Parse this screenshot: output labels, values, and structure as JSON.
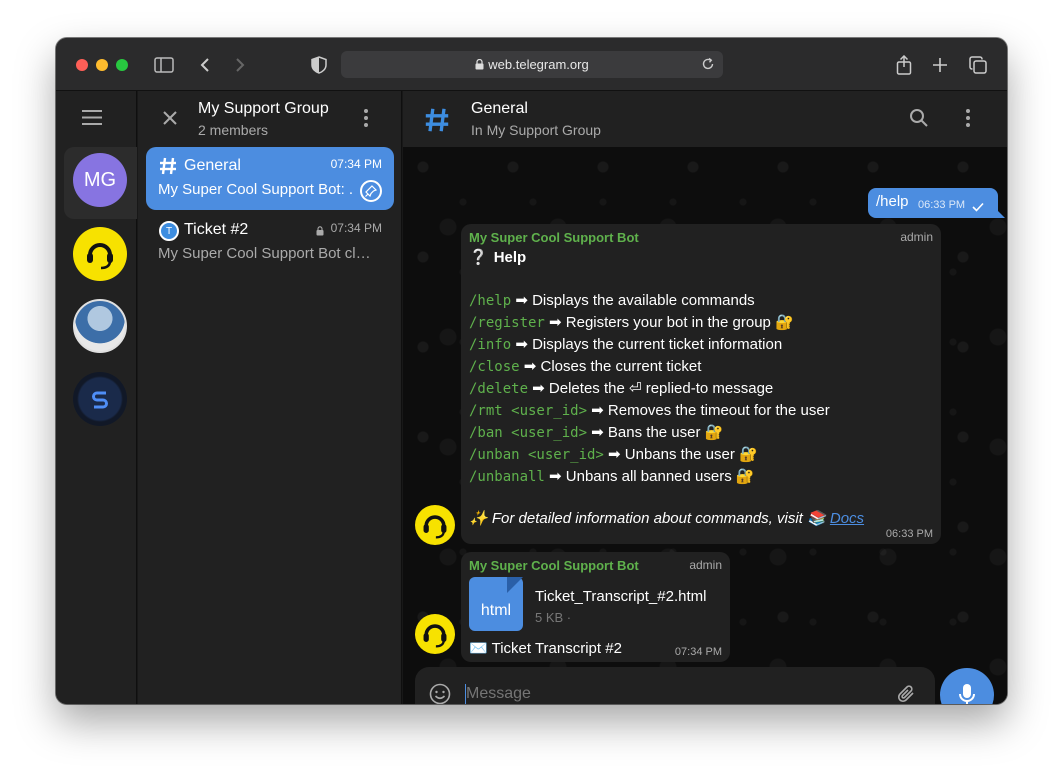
{
  "browser": {
    "url": "web.telegram.org"
  },
  "folders": {
    "items": [
      {
        "initials": "MG",
        "color": "#8774e1"
      }
    ]
  },
  "chatlist_header": {
    "title": "My Support Group",
    "subtitle": "2 members"
  },
  "chats": [
    {
      "title": "General",
      "time": "07:34 PM",
      "preview": "My Super Cool Support Bot: ...",
      "active": true
    },
    {
      "title": "Ticket #2",
      "time": "07:34 PM",
      "preview": "My Super Cool Support Bot cl…",
      "avatar_letter": "T",
      "active": false
    }
  ],
  "main_header": {
    "title": "General",
    "subtitle": "In My Support Group"
  },
  "messages": {
    "outgoing": {
      "text": "/help",
      "time": "06:33 PM"
    },
    "help": {
      "sender": "My Super Cool Support Bot",
      "badge": "admin",
      "title": "Help",
      "commands": [
        {
          "cmd": "/help",
          "desc": "Displays the available commands",
          "locked": false
        },
        {
          "cmd": "/register",
          "desc": "Registers your bot in the group",
          "locked": true
        },
        {
          "cmd": "/info",
          "desc": "Displays the current ticket information",
          "locked": false
        },
        {
          "cmd": "/close",
          "desc": "Closes the current ticket",
          "locked": false
        },
        {
          "cmd": "/delete",
          "desc": "Deletes the ⏎ replied-to message",
          "locked": false
        },
        {
          "cmd": "/rmt <user_id>",
          "desc": "Removes the timeout for the user",
          "locked": false
        },
        {
          "cmd": "/ban <user_id>",
          "desc": "Bans the user",
          "locked": true
        },
        {
          "cmd": "/unban <user_id>",
          "desc": "Unbans the user",
          "locked": true
        },
        {
          "cmd": "/unbanall",
          "desc": "Unbans all banned users",
          "locked": true
        }
      ],
      "footer_text": "For detailed information about commands, visit",
      "footer_link": "Docs",
      "time": "06:33 PM"
    },
    "file": {
      "sender": "My Super Cool Support Bot",
      "badge": "admin",
      "file_ext": "html",
      "file_name": "Ticket_Transcript_#2.html",
      "file_size": "5 KB ·",
      "caption": "Ticket Transcript #2",
      "time": "07:34 PM"
    }
  },
  "composer": {
    "placeholder": "Message"
  },
  "colors": {
    "accent": "#4c8de0",
    "sender_green": "#5fb14c",
    "bot_yellow": "#f7e200"
  }
}
